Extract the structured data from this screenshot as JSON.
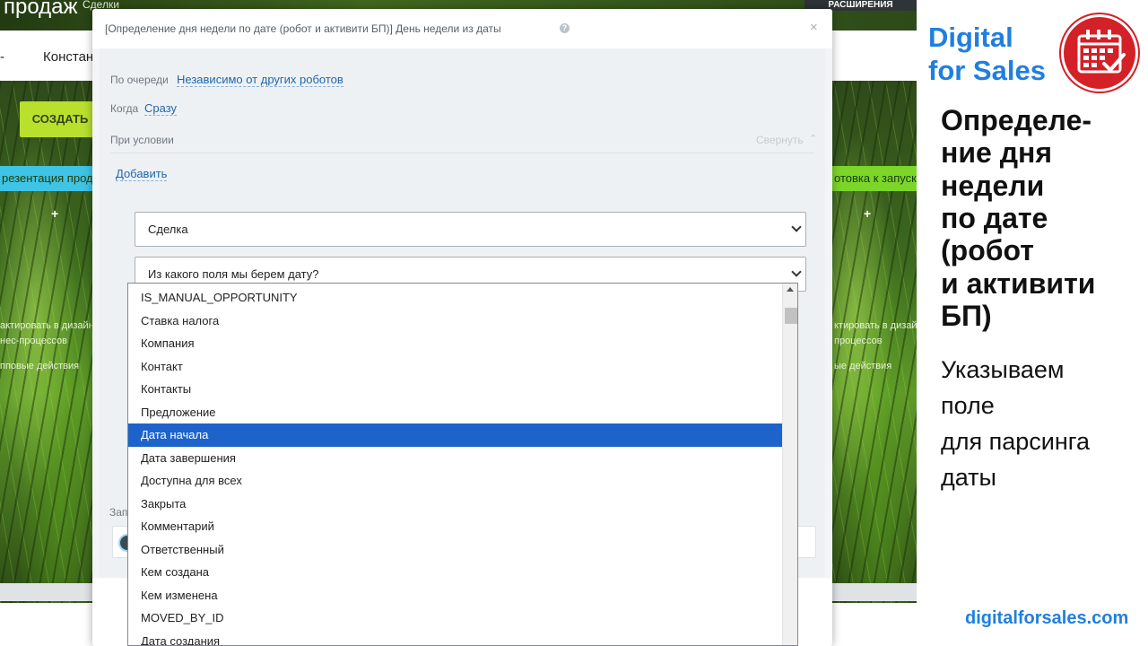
{
  "background_app": {
    "header_title": "продаж",
    "header_deals": "Сделки",
    "extensions_button": "РАСШИРЕНИЯ",
    "nav_item": "Констан",
    "nav_dash": "-",
    "create_button": "СОЗДАТЬ",
    "stage_left": "резентация проду",
    "stage_right": "отовка к запуску",
    "plus": "+",
    "left_texts": [
      "актировать в дизайне",
      "нес-процессов",
      "пповые действия"
    ],
    "right_texts": [
      "ктировать в дизайне",
      "процессов",
      "ые действия"
    ],
    "field_label": "Зап"
  },
  "dialog": {
    "title": "[Определение дня недели по дате (робот и активити БП)] День недели из даты",
    "help_icon": "?",
    "close_icon": "×",
    "queue_label": "По очереди",
    "queue_value": "Независимо от других роботов",
    "when_label": "Когда",
    "when_value": "Сразу",
    "condition_label": "При условии",
    "collapse_label": "Свернуть",
    "add_link": "Добавить",
    "entity_select": "Сделка",
    "field_select": "Из какого поля мы берем дату?"
  },
  "dropdown": {
    "selected_index": 6,
    "items": [
      "IS_MANUAL_OPPORTUNITY",
      "Ставка налога",
      "Компания",
      "Контакт",
      "Контакты",
      "Предложение",
      "Дата начала",
      "Дата завершения",
      "Доступна для всех",
      "Закрыта",
      "Комментарий",
      "Ответственный",
      "Кем создана",
      "Кем изменена",
      "MOVED_BY_ID",
      "Дата создания"
    ]
  },
  "promo": {
    "brand_line1": "Digital",
    "brand_line2": "for Sales",
    "logo_icon": "calendar-check-icon",
    "heading_lines": [
      "Определе-",
      "ние дня",
      "недели",
      "по дате",
      "(робот",
      "и активити",
      "БП)"
    ],
    "sub_lines": [
      "Указываем",
      "поле",
      "для парсинга",
      "даты"
    ],
    "url": "digitalforsales.com"
  },
  "colors": {
    "brand_blue": "#1f7fe0",
    "logo_red": "#d42027",
    "selection_blue": "#1d63c9",
    "link_blue": "#2067b0"
  }
}
